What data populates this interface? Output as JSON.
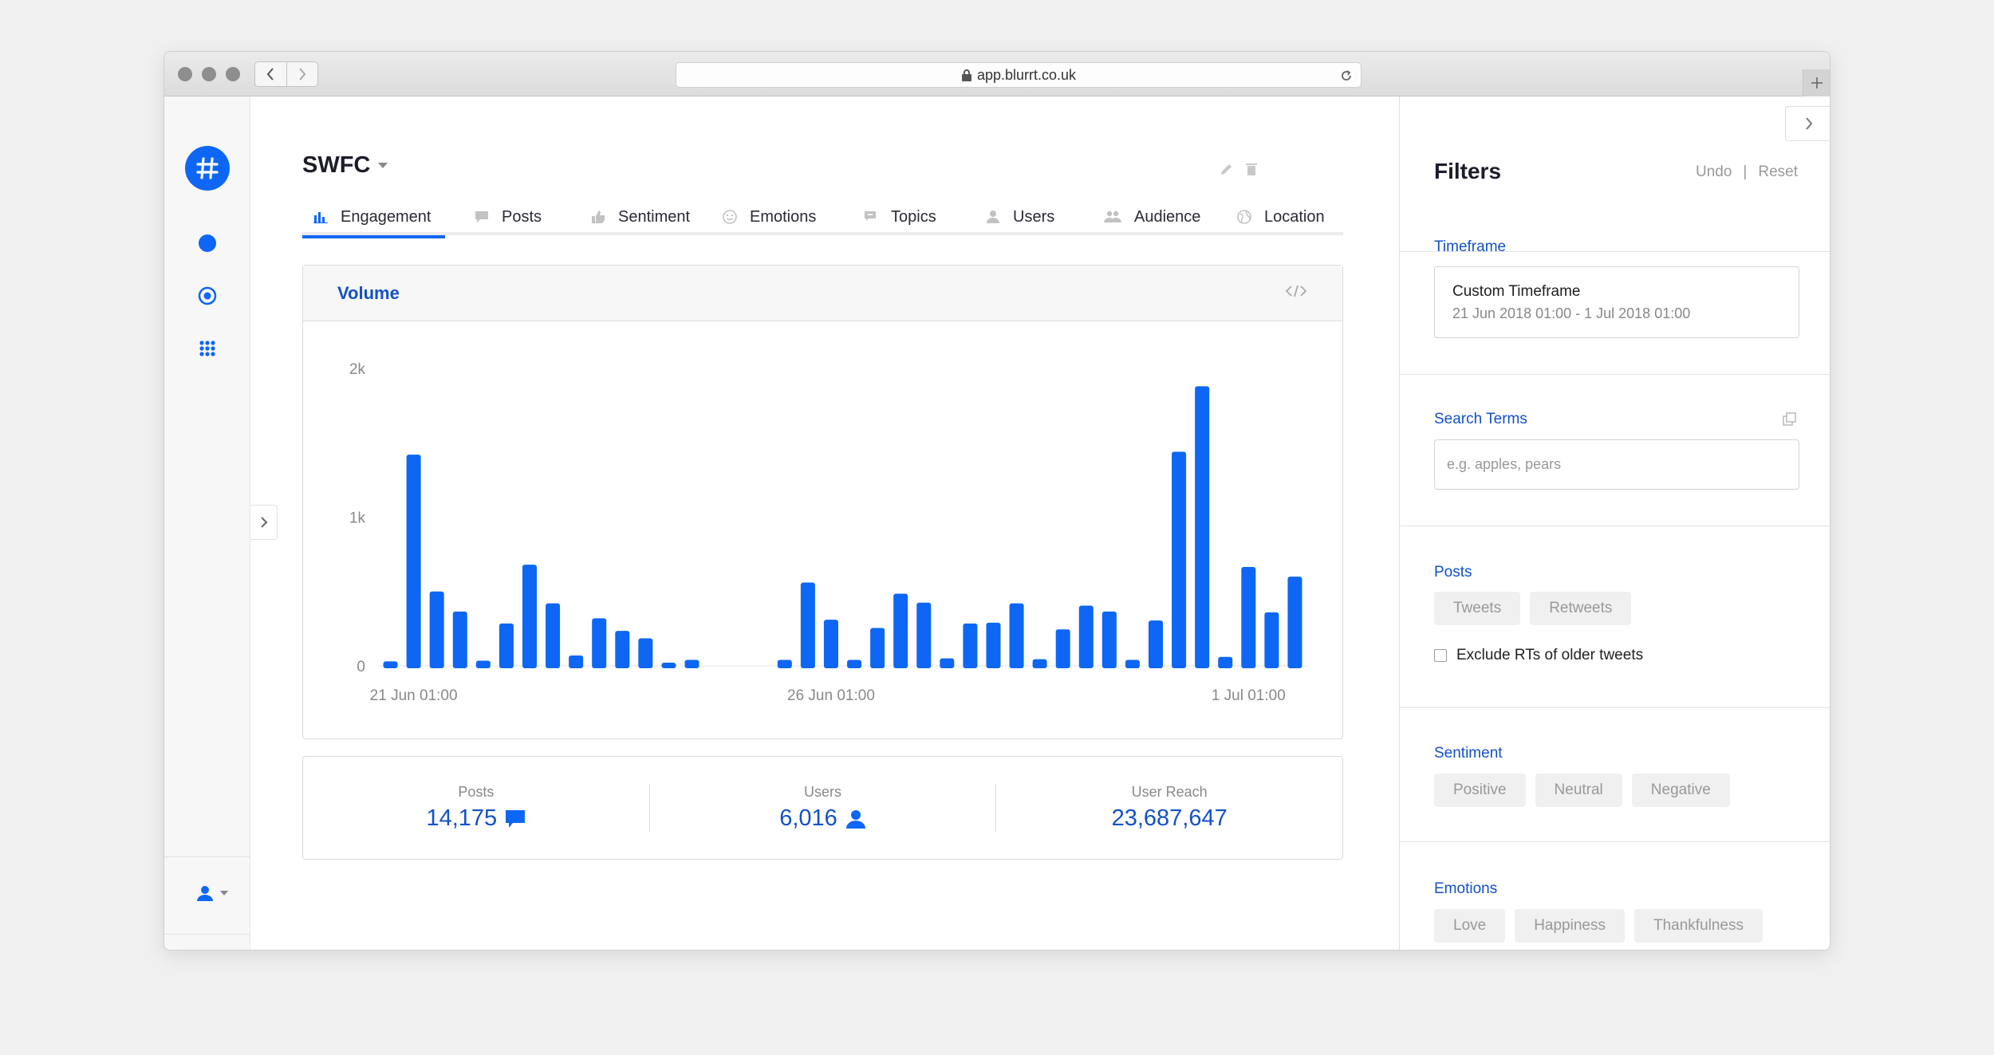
{
  "browser": {
    "url": "app.blurrt.co.uk"
  },
  "header": {
    "project_name": "SWFC"
  },
  "tabs": [
    {
      "label": "Engagement",
      "icon": "bar-chart-icon",
      "active": true
    },
    {
      "label": "Posts",
      "icon": "comment-icon",
      "active": false
    },
    {
      "label": "Sentiment",
      "icon": "thumbs-up-icon",
      "active": false
    },
    {
      "label": "Emotions",
      "icon": "smiley-icon",
      "active": false
    },
    {
      "label": "Topics",
      "icon": "chat-bubbles-icon",
      "active": false
    },
    {
      "label": "Users",
      "icon": "user-icon",
      "active": false
    },
    {
      "label": "Audience",
      "icon": "users-icon",
      "active": false
    },
    {
      "label": "Location",
      "icon": "globe-icon",
      "active": false
    }
  ],
  "volume_card": {
    "title": "Volume"
  },
  "chart_data": {
    "type": "bar",
    "title": "Volume",
    "yticks": [
      {
        "value": 0,
        "label": "0"
      },
      {
        "value": 1000,
        "label": "1k"
      },
      {
        "value": 2000,
        "label": "2k"
      }
    ],
    "ylim": [
      0,
      2000
    ],
    "xticks": [
      {
        "index": 1,
        "label": "21 Jun 01:00"
      },
      {
        "index": 19,
        "label": "26 Jun 01:00"
      },
      {
        "index": 37,
        "label": "1 Jul 01:00"
      }
    ],
    "values": [
      30,
      1420,
      500,
      365,
      35,
      285,
      680,
      420,
      70,
      320,
      235,
      185,
      20,
      40,
      0,
      0,
      0,
      40,
      560,
      310,
      40,
      255,
      485,
      425,
      50,
      285,
      290,
      420,
      45,
      245,
      405,
      365,
      40,
      305,
      1440,
      1880,
      60,
      665,
      360,
      600
    ],
    "color": "#0e66f5",
    "grid": false
  },
  "stats": [
    {
      "label": "Posts",
      "value": "14,175",
      "icon": "comment-icon"
    },
    {
      "label": "Users",
      "value": "6,016",
      "icon": "user-icon"
    },
    {
      "label": "User Reach",
      "value": "23,687,647",
      "icon": ""
    }
  ],
  "filters": {
    "title": "Filters",
    "undo_label": "Undo",
    "reset_label": "Reset",
    "timeframe": {
      "label": "Timeframe",
      "value": "Custom Timeframe",
      "range": "21 Jun 2018 01:00 - 1 Jul 2018 01:00"
    },
    "search_terms": {
      "label": "Search Terms",
      "placeholder": "e.g. apples, pears",
      "value": ""
    },
    "posts": {
      "label": "Posts",
      "options": [
        "Tweets",
        "Retweets"
      ],
      "exclude_label": "Exclude RTs of older tweets",
      "exclude_checked": false
    },
    "sentiment": {
      "label": "Sentiment",
      "options": [
        "Positive",
        "Neutral",
        "Negative"
      ]
    },
    "emotions": {
      "label": "Emotions",
      "options": [
        "Love",
        "Happiness",
        "Thankfulness"
      ]
    }
  },
  "colors": {
    "accent": "#0e66f5",
    "link": "#1251c8"
  }
}
